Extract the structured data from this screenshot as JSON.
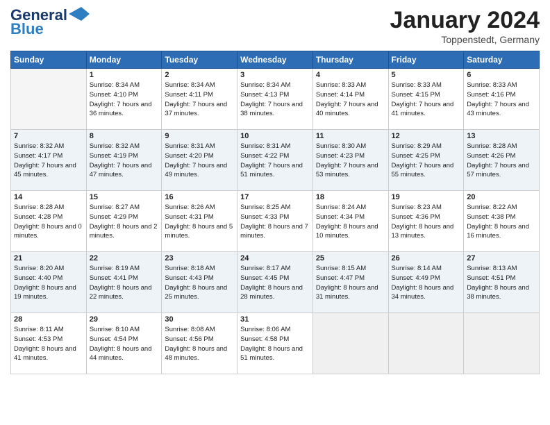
{
  "logo": {
    "line1": "General",
    "line2": "Blue"
  },
  "title": "January 2024",
  "location": "Toppenstedt, Germany",
  "days": [
    "Sunday",
    "Monday",
    "Tuesday",
    "Wednesday",
    "Thursday",
    "Friday",
    "Saturday"
  ],
  "weeks": [
    [
      {
        "day": "",
        "sunrise": "",
        "sunset": "",
        "daylight": ""
      },
      {
        "day": "1",
        "sunrise": "Sunrise: 8:34 AM",
        "sunset": "Sunset: 4:10 PM",
        "daylight": "Daylight: 7 hours and 36 minutes."
      },
      {
        "day": "2",
        "sunrise": "Sunrise: 8:34 AM",
        "sunset": "Sunset: 4:11 PM",
        "daylight": "Daylight: 7 hours and 37 minutes."
      },
      {
        "day": "3",
        "sunrise": "Sunrise: 8:34 AM",
        "sunset": "Sunset: 4:13 PM",
        "daylight": "Daylight: 7 hours and 38 minutes."
      },
      {
        "day": "4",
        "sunrise": "Sunrise: 8:33 AM",
        "sunset": "Sunset: 4:14 PM",
        "daylight": "Daylight: 7 hours and 40 minutes."
      },
      {
        "day": "5",
        "sunrise": "Sunrise: 8:33 AM",
        "sunset": "Sunset: 4:15 PM",
        "daylight": "Daylight: 7 hours and 41 minutes."
      },
      {
        "day": "6",
        "sunrise": "Sunrise: 8:33 AM",
        "sunset": "Sunset: 4:16 PM",
        "daylight": "Daylight: 7 hours and 43 minutes."
      }
    ],
    [
      {
        "day": "7",
        "sunrise": "Sunrise: 8:32 AM",
        "sunset": "Sunset: 4:17 PM",
        "daylight": "Daylight: 7 hours and 45 minutes."
      },
      {
        "day": "8",
        "sunrise": "Sunrise: 8:32 AM",
        "sunset": "Sunset: 4:19 PM",
        "daylight": "Daylight: 7 hours and 47 minutes."
      },
      {
        "day": "9",
        "sunrise": "Sunrise: 8:31 AM",
        "sunset": "Sunset: 4:20 PM",
        "daylight": "Daylight: 7 hours and 49 minutes."
      },
      {
        "day": "10",
        "sunrise": "Sunrise: 8:31 AM",
        "sunset": "Sunset: 4:22 PM",
        "daylight": "Daylight: 7 hours and 51 minutes."
      },
      {
        "day": "11",
        "sunrise": "Sunrise: 8:30 AM",
        "sunset": "Sunset: 4:23 PM",
        "daylight": "Daylight: 7 hours and 53 minutes."
      },
      {
        "day": "12",
        "sunrise": "Sunrise: 8:29 AM",
        "sunset": "Sunset: 4:25 PM",
        "daylight": "Daylight: 7 hours and 55 minutes."
      },
      {
        "day": "13",
        "sunrise": "Sunrise: 8:28 AM",
        "sunset": "Sunset: 4:26 PM",
        "daylight": "Daylight: 7 hours and 57 minutes."
      }
    ],
    [
      {
        "day": "14",
        "sunrise": "Sunrise: 8:28 AM",
        "sunset": "Sunset: 4:28 PM",
        "daylight": "Daylight: 8 hours and 0 minutes."
      },
      {
        "day": "15",
        "sunrise": "Sunrise: 8:27 AM",
        "sunset": "Sunset: 4:29 PM",
        "daylight": "Daylight: 8 hours and 2 minutes."
      },
      {
        "day": "16",
        "sunrise": "Sunrise: 8:26 AM",
        "sunset": "Sunset: 4:31 PM",
        "daylight": "Daylight: 8 hours and 5 minutes."
      },
      {
        "day": "17",
        "sunrise": "Sunrise: 8:25 AM",
        "sunset": "Sunset: 4:33 PM",
        "daylight": "Daylight: 8 hours and 7 minutes."
      },
      {
        "day": "18",
        "sunrise": "Sunrise: 8:24 AM",
        "sunset": "Sunset: 4:34 PM",
        "daylight": "Daylight: 8 hours and 10 minutes."
      },
      {
        "day": "19",
        "sunrise": "Sunrise: 8:23 AM",
        "sunset": "Sunset: 4:36 PM",
        "daylight": "Daylight: 8 hours and 13 minutes."
      },
      {
        "day": "20",
        "sunrise": "Sunrise: 8:22 AM",
        "sunset": "Sunset: 4:38 PM",
        "daylight": "Daylight: 8 hours and 16 minutes."
      }
    ],
    [
      {
        "day": "21",
        "sunrise": "Sunrise: 8:20 AM",
        "sunset": "Sunset: 4:40 PM",
        "daylight": "Daylight: 8 hours and 19 minutes."
      },
      {
        "day": "22",
        "sunrise": "Sunrise: 8:19 AM",
        "sunset": "Sunset: 4:41 PM",
        "daylight": "Daylight: 8 hours and 22 minutes."
      },
      {
        "day": "23",
        "sunrise": "Sunrise: 8:18 AM",
        "sunset": "Sunset: 4:43 PM",
        "daylight": "Daylight: 8 hours and 25 minutes."
      },
      {
        "day": "24",
        "sunrise": "Sunrise: 8:17 AM",
        "sunset": "Sunset: 4:45 PM",
        "daylight": "Daylight: 8 hours and 28 minutes."
      },
      {
        "day": "25",
        "sunrise": "Sunrise: 8:15 AM",
        "sunset": "Sunset: 4:47 PM",
        "daylight": "Daylight: 8 hours and 31 minutes."
      },
      {
        "day": "26",
        "sunrise": "Sunrise: 8:14 AM",
        "sunset": "Sunset: 4:49 PM",
        "daylight": "Daylight: 8 hours and 34 minutes."
      },
      {
        "day": "27",
        "sunrise": "Sunrise: 8:13 AM",
        "sunset": "Sunset: 4:51 PM",
        "daylight": "Daylight: 8 hours and 38 minutes."
      }
    ],
    [
      {
        "day": "28",
        "sunrise": "Sunrise: 8:11 AM",
        "sunset": "Sunset: 4:53 PM",
        "daylight": "Daylight: 8 hours and 41 minutes."
      },
      {
        "day": "29",
        "sunrise": "Sunrise: 8:10 AM",
        "sunset": "Sunset: 4:54 PM",
        "daylight": "Daylight: 8 hours and 44 minutes."
      },
      {
        "day": "30",
        "sunrise": "Sunrise: 8:08 AM",
        "sunset": "Sunset: 4:56 PM",
        "daylight": "Daylight: 8 hours and 48 minutes."
      },
      {
        "day": "31",
        "sunrise": "Sunrise: 8:06 AM",
        "sunset": "Sunset: 4:58 PM",
        "daylight": "Daylight: 8 hours and 51 minutes."
      },
      {
        "day": "",
        "sunrise": "",
        "sunset": "",
        "daylight": ""
      },
      {
        "day": "",
        "sunrise": "",
        "sunset": "",
        "daylight": ""
      },
      {
        "day": "",
        "sunrise": "",
        "sunset": "",
        "daylight": ""
      }
    ]
  ]
}
